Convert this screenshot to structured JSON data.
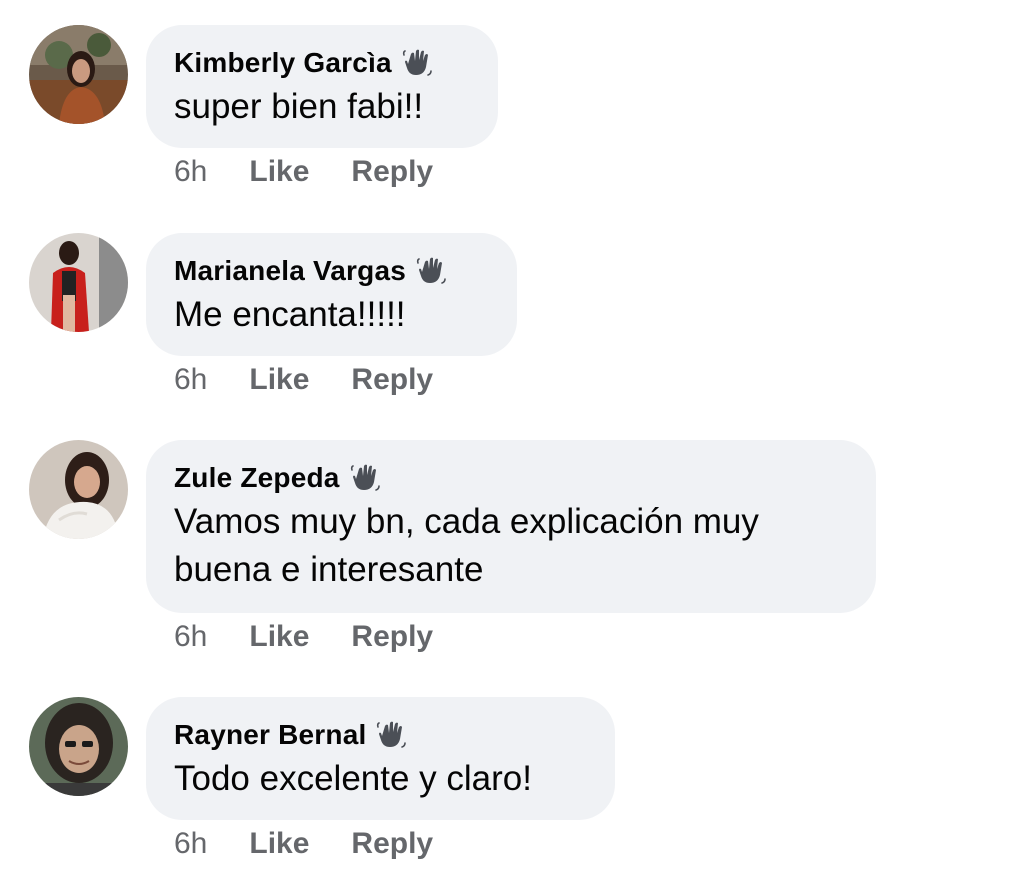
{
  "comments": [
    {
      "author": "Kimberly Garcìa",
      "text": "super bien fabi!!",
      "time": "6h",
      "like_label": "Like",
      "reply_label": "Reply",
      "badge_icon": "waving-hand-icon"
    },
    {
      "author": "Marianela Vargas",
      "text": "Me encanta!!!!!",
      "time": "6h",
      "like_label": "Like",
      "reply_label": "Reply",
      "badge_icon": "waving-hand-icon"
    },
    {
      "author": "Zule Zepeda",
      "text": "Vamos muy bn, cada explicación muy buena e interesante",
      "time": "6h",
      "like_label": "Like",
      "reply_label": "Reply",
      "badge_icon": "waving-hand-icon"
    },
    {
      "author": "Rayner Bernal",
      "text": "Todo excelente y claro!",
      "time": "6h",
      "like_label": "Like",
      "reply_label": "Reply",
      "badge_icon": "waving-hand-icon"
    }
  ],
  "colors": {
    "bubble_bg": "#f0f2f5",
    "meta_text": "#65676b",
    "primary_text": "#050505"
  }
}
